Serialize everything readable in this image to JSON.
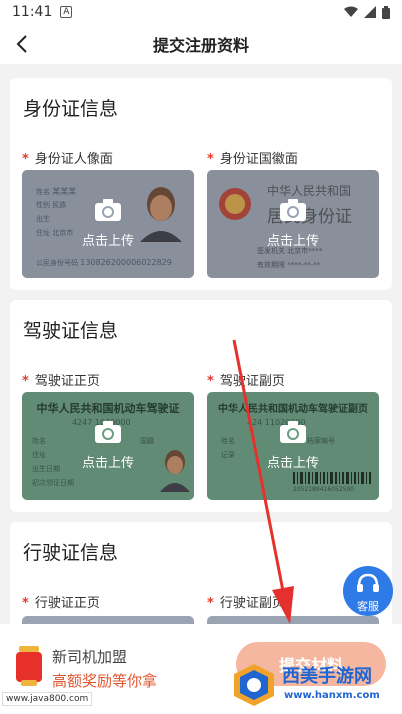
{
  "status": {
    "time": "11:41",
    "a_badge": "A"
  },
  "nav": {
    "title": "提交注册资料"
  },
  "sections": {
    "id_card": {
      "title": "身份证信息",
      "front_label": "身份证人像面",
      "back_label": "身份证国徽面",
      "front_sample": {
        "name_label": "姓名",
        "name_value": "某某某",
        "gender_label": "性别",
        "ethnic_label": "民族",
        "birth_label": "出生",
        "address_label": "住址",
        "address_value": "北京市",
        "id_label": "公民身份号码",
        "id_value": "130826200006022829"
      },
      "back_sample": {
        "country": "中华人民共和国",
        "doc": "居民身份证",
        "authority_label": "签发机关",
        "authority_value": "北京市****",
        "valid_label": "有效期限",
        "valid_value": "****-**-**"
      }
    },
    "driver": {
      "title": "驾驶证信息",
      "front_label": "驾驶证正页",
      "back_label": "驾驶证副页",
      "front_sample": {
        "title": "中华人民共和国机动车驾驶证",
        "number": "4247 1020000",
        "name_label": "姓名",
        "nationality_label": "国籍",
        "address_label": "住址",
        "birth_label": "出生日期",
        "first_label": "初次领证日期"
      },
      "back_sample": {
        "title": "中华人民共和国机动车驾驶证副页",
        "number": "424 11020000",
        "name_label": "姓名",
        "file_label": "档案编号",
        "record_label": "记录",
        "barcode": "2052189416052590"
      }
    },
    "vehicle": {
      "title": "行驶证信息",
      "front_label": "行驶证正页",
      "back_label": "行驶证副页"
    }
  },
  "upload_text": "点击上传",
  "required_mark": "*",
  "service": {
    "label": "客服"
  },
  "bottom": {
    "line1": "新司机加盟",
    "line2": "高额奖励等你拿",
    "submit": "提交材料"
  },
  "watermark": {
    "url": "www.java800.com",
    "brand": "西美手游网",
    "domain": "www.hanxm.com"
  },
  "colors": {
    "accent": "#e0572f",
    "required": "#e23c2e",
    "service": "#2e7ae6",
    "submit_bg": "#f6b7a0"
  }
}
